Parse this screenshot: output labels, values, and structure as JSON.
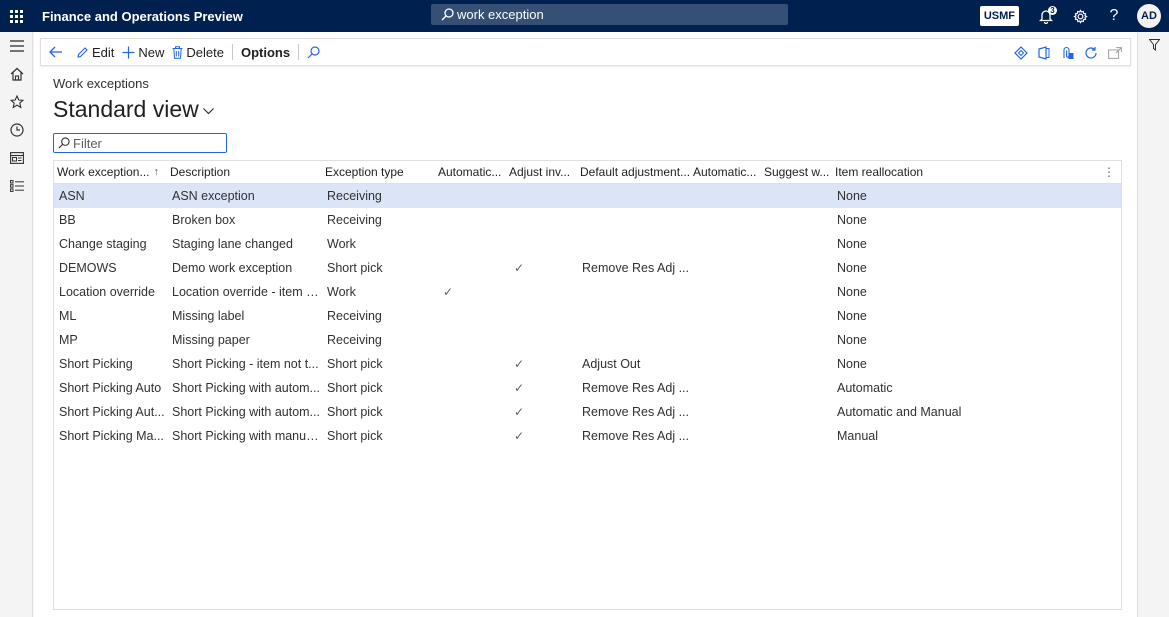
{
  "app": {
    "title": "Finance and Operations Preview"
  },
  "search": {
    "value": "work exception"
  },
  "header": {
    "company": "USMF",
    "notification_count": "3",
    "avatar_initials": "AD"
  },
  "actions": {
    "edit": "Edit",
    "new": "New",
    "delete": "Delete",
    "options": "Options"
  },
  "page": {
    "caption": "Work exceptions",
    "view_name": "Standard view",
    "filter_placeholder": "Filter"
  },
  "grid": {
    "columns": [
      "Work exception...",
      "Description",
      "Exception type",
      "Automatic...",
      "Adjust inv...",
      "Default adjustment...",
      "Automatic...",
      "Suggest w...",
      "Item reallocation"
    ],
    "sort_column": "Work exception...",
    "rows": [
      {
        "code": "ASN",
        "description": "ASN exception",
        "type": "Receiving",
        "auto1": "",
        "adjust": "",
        "default_adj": "",
        "auto2": "",
        "suggest": "",
        "realloc": "None"
      },
      {
        "code": "BB",
        "description": "Broken box",
        "type": "Receiving",
        "auto1": "",
        "adjust": "",
        "default_adj": "",
        "auto2": "",
        "suggest": "",
        "realloc": "None"
      },
      {
        "code": "Change staging",
        "description": "Staging lane changed",
        "type": "Work",
        "auto1": "",
        "adjust": "",
        "default_adj": "",
        "auto2": "",
        "suggest": "",
        "realloc": "None"
      },
      {
        "code": "DEMOWS",
        "description": "Demo work exception",
        "type": "Short pick",
        "auto1": "",
        "adjust": "✓",
        "default_adj": "Remove Res Adj ...",
        "auto2": "",
        "suggest": "",
        "realloc": "None"
      },
      {
        "code": "Location override",
        "description": "Location override - item n...",
        "type": "Work",
        "auto1": "✓",
        "adjust": "",
        "default_adj": "",
        "auto2": "",
        "suggest": "",
        "realloc": "None"
      },
      {
        "code": "ML",
        "description": "Missing label",
        "type": "Receiving",
        "auto1": "",
        "adjust": "",
        "default_adj": "",
        "auto2": "",
        "suggest": "",
        "realloc": "None"
      },
      {
        "code": "MP",
        "description": "Missing paper",
        "type": "Receiving",
        "auto1": "",
        "adjust": "",
        "default_adj": "",
        "auto2": "",
        "suggest": "",
        "realloc": "None"
      },
      {
        "code": "Short Picking",
        "description": "Short Picking - item not t...",
        "type": "Short pick",
        "auto1": "",
        "adjust": "✓",
        "default_adj": "Adjust Out",
        "auto2": "",
        "suggest": "",
        "realloc": "None"
      },
      {
        "code": "Short Picking Auto",
        "description": "Short Picking with autom...",
        "type": "Short pick",
        "auto1": "",
        "adjust": "✓",
        "default_adj": "Remove Res Adj ...",
        "auto2": "",
        "suggest": "",
        "realloc": "Automatic"
      },
      {
        "code": "Short Picking Aut...",
        "description": "Short Picking with autom...",
        "type": "Short pick",
        "auto1": "",
        "adjust": "✓",
        "default_adj": "Remove Res Adj ...",
        "auto2": "",
        "suggest": "",
        "realloc": "Automatic and Manual"
      },
      {
        "code": "Short Picking Ma...",
        "description": "Short Picking with manua...",
        "type": "Short pick",
        "auto1": "",
        "adjust": "✓",
        "default_adj": "Remove Res Adj ...",
        "auto2": "",
        "suggest": "",
        "realloc": "Manual"
      }
    ],
    "selected_row": 0
  },
  "colors": {
    "topbar": "#002050",
    "accent": "#2266e3",
    "selected_row": "#dce5f8"
  }
}
